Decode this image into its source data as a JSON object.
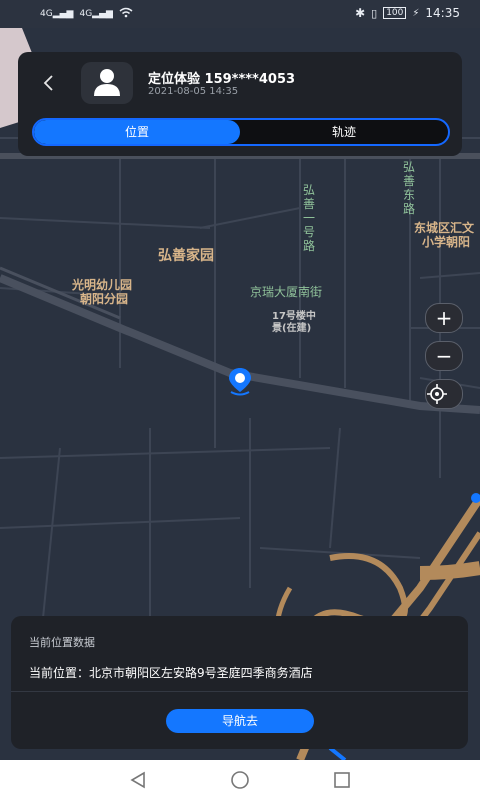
{
  "status_bar": {
    "signal1": "4G",
    "signal2": "4G",
    "battery": "100",
    "time": "14:35"
  },
  "header": {
    "back_icon": "chevron-left-icon",
    "avatar_icon": "user-icon",
    "title": "定位体验 159****4053",
    "timestamp": "2021-08-05 14:35",
    "tabs": [
      {
        "label": "位置",
        "active": true
      },
      {
        "label": "轨迹",
        "active": false
      }
    ]
  },
  "map": {
    "labels": [
      {
        "text": "弘善家园"
      },
      {
        "text": "光明幼儿园"
      },
      {
        "text": "朝阳分园"
      },
      {
        "text": "京瑞大厦南街"
      },
      {
        "text": "17号楼中"
      },
      {
        "text": "景(在建)"
      },
      {
        "text": "弘善一号路"
      },
      {
        "text": "弘善东路"
      },
      {
        "text": "东城区汇文"
      },
      {
        "text": "小学朝阳"
      }
    ],
    "controls": {
      "zoom_in": "+",
      "zoom_out": "−",
      "locate_icon": "crosshair-icon"
    },
    "colors": {
      "background": "#2a3240",
      "road": "#3d4554",
      "highway": "#b38a5b",
      "label_brown": "#d8b58a",
      "label_green": "#90c29a",
      "accent": "#1477ff"
    }
  },
  "bottom_panel": {
    "heading": "当前位置数据",
    "location_label": "当前位置：",
    "location_value": "北京市朝阳区左安路9号圣庭四季商务酒店",
    "navigate_button": "导航去"
  },
  "system_nav": {
    "back_icon": "triangle-back-icon",
    "home_icon": "circle-home-icon",
    "recents_icon": "square-recents-icon"
  }
}
